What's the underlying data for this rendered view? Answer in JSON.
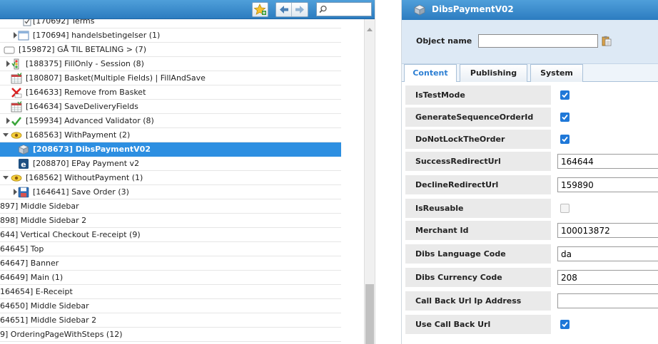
{
  "toolbar": {
    "favorites_icon": "star-add-icon",
    "back_icon": "arrow-left-icon",
    "forward_icon": "arrow-right-icon",
    "search_icon": "magnifier-icon",
    "search_value": ""
  },
  "tree": {
    "rows": [
      {
        "text": "[170692] Terms",
        "icon": "checkbox-page-icon"
      },
      {
        "text": "[170694] handelsbetingelser (1)",
        "icon": "window-icon"
      },
      {
        "text": "[159872] GÅ TIL BETALING    > (7)",
        "icon": "folder-open-icon"
      },
      {
        "text": "[188375] FillOnly - Session (8)",
        "icon": "traffic-light-icon"
      },
      {
        "text": "[180807] Basket(Multiple Fields) | FillAndSave",
        "icon": "calendar-grid-icon"
      },
      {
        "text": "[164633] Remove from Basket",
        "icon": "red-x-icon"
      },
      {
        "text": "[164634] SaveDeliveryFields",
        "icon": "calendar-grid-icon"
      },
      {
        "text": "[159934] Advanced Validator (8)",
        "icon": "green-check-icon"
      },
      {
        "text": "[168563] WithPayment (2)",
        "icon": "eye-condition-icon"
      },
      {
        "text": "[208673] DibsPaymentV02",
        "icon": "cube-icon"
      },
      {
        "text": "[208870] EPay Payment v2",
        "icon": "epay-icon"
      },
      {
        "text": "[168562] WithoutPayment (1)",
        "icon": "eye-condition-icon"
      },
      {
        "text": "[164641] Save Order (3)",
        "icon": "floppy-disk-icon"
      },
      {
        "text": "897] Middle Sidebar",
        "icon": ""
      },
      {
        "text": "898] Middle Sidebar 2",
        "icon": ""
      },
      {
        "text": "644] Vertical Checkout E-receipt (9)",
        "icon": ""
      },
      {
        "text": "64645] Top",
        "icon": ""
      },
      {
        "text": "64647] Banner",
        "icon": ""
      },
      {
        "text": "64649] Main (1)",
        "icon": ""
      },
      {
        "text": "164654] E-Receipt",
        "icon": ""
      },
      {
        "text": "64650] Middle Sidebar",
        "icon": ""
      },
      {
        "text": "64651] Middle Sidebar 2",
        "icon": ""
      },
      {
        "text": "9] OrderingPageWithSteps (12)",
        "icon": ""
      }
    ]
  },
  "panel": {
    "title": "DibsPaymentV02",
    "title_icon": "cube-icon",
    "object_name_label": "Object name",
    "object_name_value": "",
    "picker_icon": "clipboard-icon",
    "tabs": [
      {
        "label": "Content",
        "active": true
      },
      {
        "label": "Publishing",
        "active": false
      },
      {
        "label": "System",
        "active": false
      }
    ],
    "fields": [
      {
        "label": "IsTestMode",
        "kind": "checkbox",
        "checked": true
      },
      {
        "label": "GenerateSequenceOrderId",
        "kind": "checkbox",
        "checked": true
      },
      {
        "label": "DoNotLockTheOrder",
        "kind": "checkbox",
        "checked": true
      },
      {
        "label": "SuccessRedirectUrl",
        "kind": "text",
        "value": "164644"
      },
      {
        "label": "DeclineRedirectUrl",
        "kind": "text",
        "value": "159890"
      },
      {
        "label": "IsReusable",
        "kind": "checkbox",
        "checked": false
      },
      {
        "label": "Merchant Id",
        "kind": "text",
        "value": "100013872"
      },
      {
        "label": "Dibs Language Code",
        "kind": "text",
        "value": "da"
      },
      {
        "label": "Dibs Currency Code",
        "kind": "text",
        "value": "208"
      },
      {
        "label": "Call Back Url Ip Address",
        "kind": "text",
        "value": ""
      },
      {
        "label": "Use Call Back Url",
        "kind": "checkbox",
        "checked": true
      }
    ]
  },
  "colors": {
    "header_blue": "#2c7cc0",
    "selection_blue": "#2d8fe1",
    "tab_active_text": "#2d7fd3",
    "checkbox_blue": "#1f78d8"
  }
}
